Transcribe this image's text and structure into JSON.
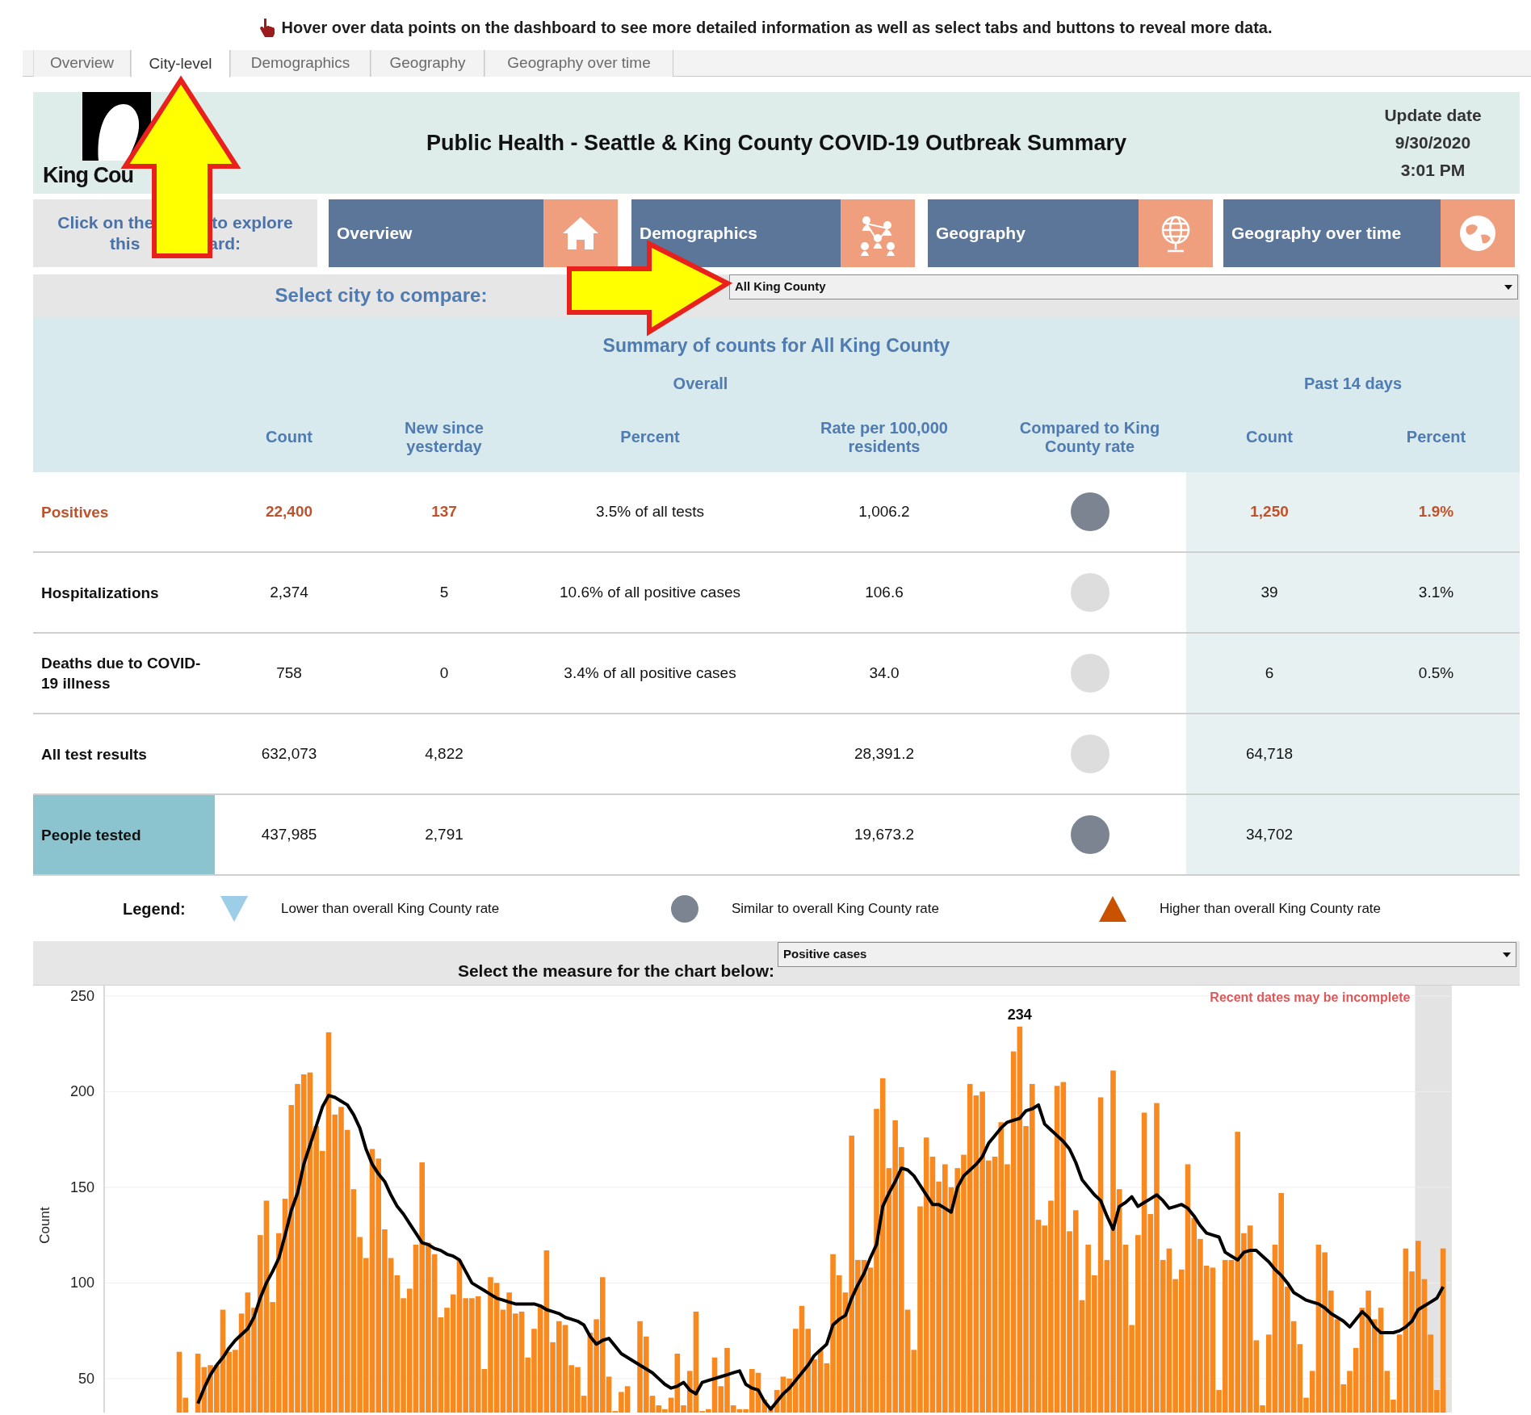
{
  "instruction": {
    "text": "Hover over data points on the dashboard to see more detailed information as well as select tabs and buttons to reveal more data."
  },
  "tabs": [
    {
      "label": "Overview",
      "selected": false
    },
    {
      "label": "City-level",
      "selected": true
    },
    {
      "label": "Demographics",
      "selected": false
    },
    {
      "label": "Geography",
      "selected": false
    },
    {
      "label": "Geography over time",
      "selected": false
    }
  ],
  "header": {
    "logo_text": "King Cou",
    "title": "Public Health - Seattle & King County COVID-19 Outbreak Summary",
    "update_label": "Update date",
    "update_date": "9/30/2020",
    "update_time": "3:01 PM"
  },
  "nav": {
    "prompt_line_1": [
      "Click on the",
      "to explore"
    ],
    "prompt_line_2": [
      "this",
      "ard:"
    ],
    "buttons": [
      {
        "label": "Overview",
        "kind": "house"
      },
      {
        "label": "Demographics",
        "kind": "people"
      },
      {
        "label": "Geography",
        "kind": "globe"
      },
      {
        "label": "Geography over time",
        "kind": "earth"
      }
    ]
  },
  "city_select": {
    "label": "Select city to compare:",
    "value": "All King County"
  },
  "summary": {
    "title": "Summary of counts for All King County",
    "group_overall": "Overall",
    "group_recent": "Past 14 days",
    "columns": [
      "Count",
      "New since yesterday",
      "Percent",
      "Rate per 100,000 residents",
      "Compared to King County rate",
      "Count",
      "Percent"
    ],
    "rows": [
      {
        "label": "Positives",
        "kind": "alert",
        "selected": false,
        "count": "22,400",
        "new": "137",
        "percent": "3.5% of all tests",
        "rate": "1,006.2",
        "color": "#7b8490",
        "count_14": "1,250",
        "percent_14": "1.9%"
      },
      {
        "label": "Hospitalizations",
        "kind": "normal",
        "selected": false,
        "count": "2,374",
        "new": "5",
        "percent": "10.6% of all positive cases",
        "rate": "106.6",
        "color": "#dddddd",
        "count_14": "39",
        "percent_14": "3.1%"
      },
      {
        "label": "Deaths due to COVID-19 illness",
        "kind": "normal",
        "selected": false,
        "count": "758",
        "new": "0",
        "percent": "3.4% of all positive cases",
        "rate": "34.0",
        "color": "#dddddd",
        "count_14": "6",
        "percent_14": "0.5%"
      },
      {
        "label": "All test results",
        "kind": "normal",
        "selected": false,
        "count": "632,073",
        "new": "4,822",
        "rate": "28,391.2",
        "color": "#dddddd",
        "count_14": "64,718"
      },
      {
        "label": "People tested",
        "kind": "normal",
        "selected": true,
        "count": "437,985",
        "new": "2,791",
        "rate": "19,673.2",
        "color": "#7b8490",
        "count_14": "34,702"
      }
    ]
  },
  "legend": {
    "label": "Legend:",
    "items": [
      {
        "kind": "triangle-down",
        "color": "#9ecde8",
        "text": "Lower than overall King County rate"
      },
      {
        "kind": "circle",
        "color": "#7b8490",
        "text": "Similar to overall King County rate"
      },
      {
        "kind": "triangle-up",
        "color": "#c85200",
        "text": "Higher than overall King County rate"
      }
    ]
  },
  "measure_select": {
    "label": "Select the measure for the chart below:",
    "value": "Positive cases"
  },
  "chart": {
    "note": "Recent dates may be incomplete",
    "chart_data": {
      "type": "bar",
      "ylabel": "Count",
      "ylim": [
        32,
        255
      ],
      "yticks": [
        50,
        100,
        150,
        200,
        250
      ],
      "grid": true,
      "series": [
        {
          "color": "#f7891f",
          "values": [
            64,
            40,
            null,
            63,
            56,
            57,
            57,
            86,
            64,
            65,
            84,
            95,
            87,
            125,
            143,
            90,
            126,
            144,
            193,
            204,
            209,
            210,
            182,
            169,
            231,
            188,
            192,
            180,
            149,
            124,
            113,
            170,
            165,
            128,
            113,
            104,
            92,
            97,
            120,
            163,
            121,
            115,
            82,
            87,
            94,
            112,
            92,
            92,
            93,
            55,
            103,
            100,
            86,
            95,
            84,
            85,
            61,
            76,
            88,
            117,
            69,
            80,
            78,
            57,
            56,
            41,
            74,
            81,
            103,
            51,
            33,
            43,
            46,
            null,
            80,
            72,
            41,
            36,
            34,
            40,
            63,
            36,
            54,
            85,
            33,
            34,
            61,
            46,
            66,
            36,
            34,
            34,
            55,
            53,
            39,
            35,
            44,
            51,
            50,
            76,
            88,
            76,
            60,
            65,
            58,
            115,
            104,
            95,
            177,
            112,
            112,
            108,
            191,
            207,
            160,
            185,
            171,
            86,
            65,
            140,
            176,
            166,
            153,
            162,
            150,
            160,
            167,
            204,
            198,
            200,
            164,
            166,
            184,
            162,
            221,
            234,
            182,
            204,
            133,
            130,
            143,
            203,
            205,
            127,
            138,
            91,
            120,
            104,
            197,
            112,
            211,
            149,
            120,
            78,
            125,
            189,
            136,
            194,
            112,
            118,
            102,
            107,
            162,
            134,
            123,
            109,
            108,
            44,
            112,
            112,
            179,
            126,
            130,
            70,
            36,
            73,
            120,
            147,
            98,
            80,
            68,
            40,
            54,
            120,
            116,
            96,
            81,
            47,
            54,
            66,
            87,
            96,
            81,
            87,
            54,
            39,
            73,
            118,
            106,
            122,
            102,
            73,
            44,
            118
          ]
        },
        {
          "type": "line",
          "color": "#000000",
          "values": [
            null,
            null,
            null,
            37,
            45,
            52,
            57,
            61,
            66,
            70,
            73,
            76,
            82,
            92,
            100,
            106,
            113,
            125,
            138,
            147,
            162,
            172,
            182,
            192,
            198,
            197,
            195,
            193,
            188,
            181,
            170,
            162,
            157,
            153,
            146,
            140,
            136,
            131,
            126,
            121,
            120,
            118,
            117,
            115,
            114,
            112,
            106,
            100,
            98,
            96,
            94,
            92,
            91,
            90,
            89,
            89,
            89,
            89,
            88,
            86,
            85,
            84,
            82,
            81,
            80,
            78,
            72,
            68,
            70,
            71,
            67,
            63,
            61,
            59,
            57,
            55,
            53,
            50,
            47,
            45,
            46,
            48,
            44,
            42,
            48,
            49,
            50,
            51,
            52,
            53,
            54,
            47,
            45,
            44,
            38,
            34,
            38,
            42,
            45,
            49,
            53,
            57,
            62,
            65,
            68,
            78,
            81,
            83,
            92,
            99,
            105,
            113,
            120,
            140,
            147,
            153,
            160,
            159,
            156,
            151,
            146,
            141,
            141,
            139,
            137,
            150,
            156,
            159,
            162,
            166,
            173,
            177,
            181,
            184,
            185,
            186,
            190,
            191,
            193,
            183,
            180,
            177,
            174,
            170,
            163,
            154,
            150,
            146,
            143,
            135,
            128,
            140,
            142,
            145,
            140,
            142,
            144,
            146,
            143,
            139,
            140,
            141,
            139,
            135,
            130,
            126,
            125,
            124,
            116,
            114,
            112,
            116,
            117,
            117,
            114,
            111,
            107,
            104,
            100,
            95,
            93,
            91,
            90,
            89,
            87,
            84,
            82,
            80,
            77,
            81,
            85,
            82,
            77,
            74,
            74,
            74,
            75,
            77,
            80,
            86,
            88,
            90,
            92,
            98
          ]
        }
      ],
      "annotations": [
        {
          "text": "234"
        }
      ]
    }
  }
}
